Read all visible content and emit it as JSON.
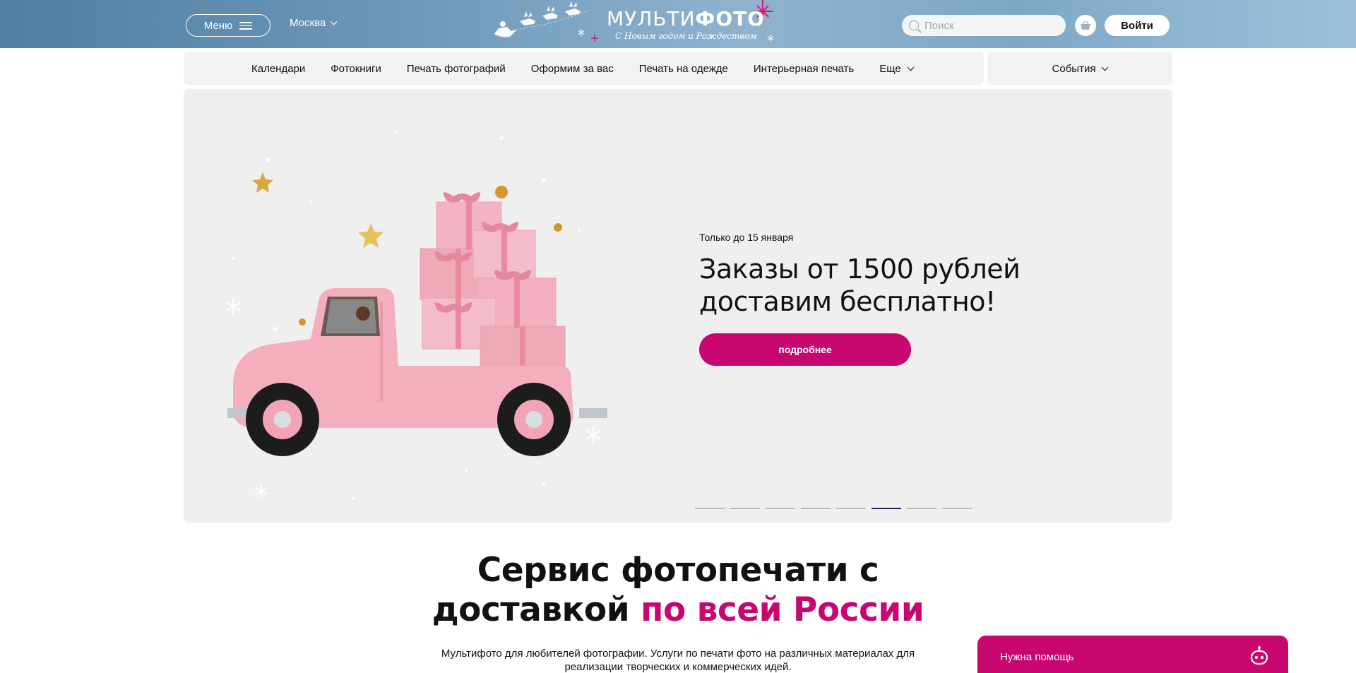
{
  "header": {
    "menu_label": "Меню",
    "city": "Москва",
    "logo": {
      "word_thin": "МУЛЬТИ",
      "word_bold": "ФОТО",
      "tagline": "С Новым годом и Рождеством"
    },
    "search_placeholder": "Поиск",
    "login_label": "Войти"
  },
  "nav": {
    "items": [
      {
        "label": "Календари"
      },
      {
        "label": "Фотокниги"
      },
      {
        "label": "Печать фотографий"
      },
      {
        "label": "Оформим за вас"
      },
      {
        "label": "Печать на одежде"
      },
      {
        "label": "Интерьерная печать"
      },
      {
        "label": "Еще"
      }
    ],
    "events_label": "События"
  },
  "hero": {
    "kicker": "Только до 15 января",
    "title": "Заказы от 1500 рублей доставим бесплатно!",
    "button_label": "подробнее",
    "slides_total": 8,
    "active_slide": 6
  },
  "intro": {
    "title_part1": "Сервис фотопечати с доставкой",
    "title_accent": "по всей России",
    "description": "Мультифото для любителей фотографии. Услуги по печати фото на различных материалах для реализации творческих и коммерческих идей."
  },
  "help": {
    "label": "Нужна помощь"
  },
  "colors": {
    "accent": "#c8066f",
    "header_blue": "#6e98ba",
    "nav_bg": "#f2f2f2",
    "hero_bg": "#efefef"
  },
  "icons": [
    "burger-icon",
    "chevron-down-icon",
    "search-icon",
    "basket-icon",
    "robot-icon",
    "reindeer-sleigh-icon",
    "star-icon",
    "snowflake-icon"
  ]
}
